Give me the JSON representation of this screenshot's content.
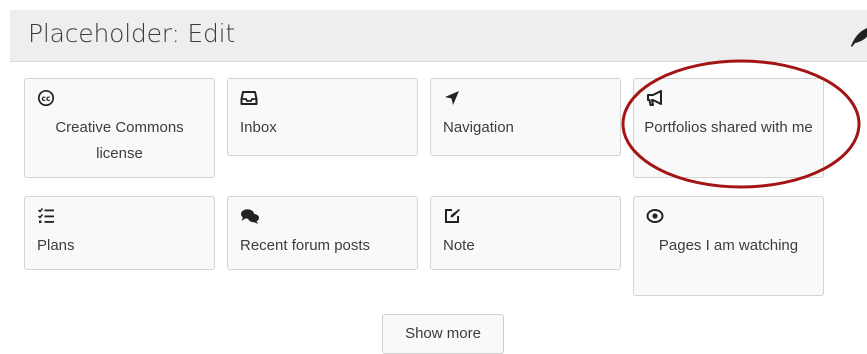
{
  "header": {
    "title": "Placeholder: Edit",
    "edit_icon": "feather-pen-icon"
  },
  "blocks": [
    {
      "label": "Creative Commons license",
      "icon": "creative-commons-icon"
    },
    {
      "label": "Inbox",
      "icon": "inbox-tray-icon"
    },
    {
      "label": "Navigation",
      "icon": "location-arrow-icon"
    },
    {
      "label": "Portfolios shared with me",
      "icon": "bullhorn-icon"
    },
    {
      "label": "Plans",
      "icon": "checklist-icon"
    },
    {
      "label": "Recent forum posts",
      "icon": "comments-icon"
    },
    {
      "label": "Note",
      "icon": "pen-square-icon"
    },
    {
      "label": "Pages I am watching",
      "icon": "eye-icon"
    }
  ],
  "show_more_label": "Show more",
  "colors": {
    "header_bg": "#eeeeee",
    "tile_bg": "#f9f9f9",
    "tile_border": "#d4d4d4",
    "annotation_ring": "#a31515"
  }
}
